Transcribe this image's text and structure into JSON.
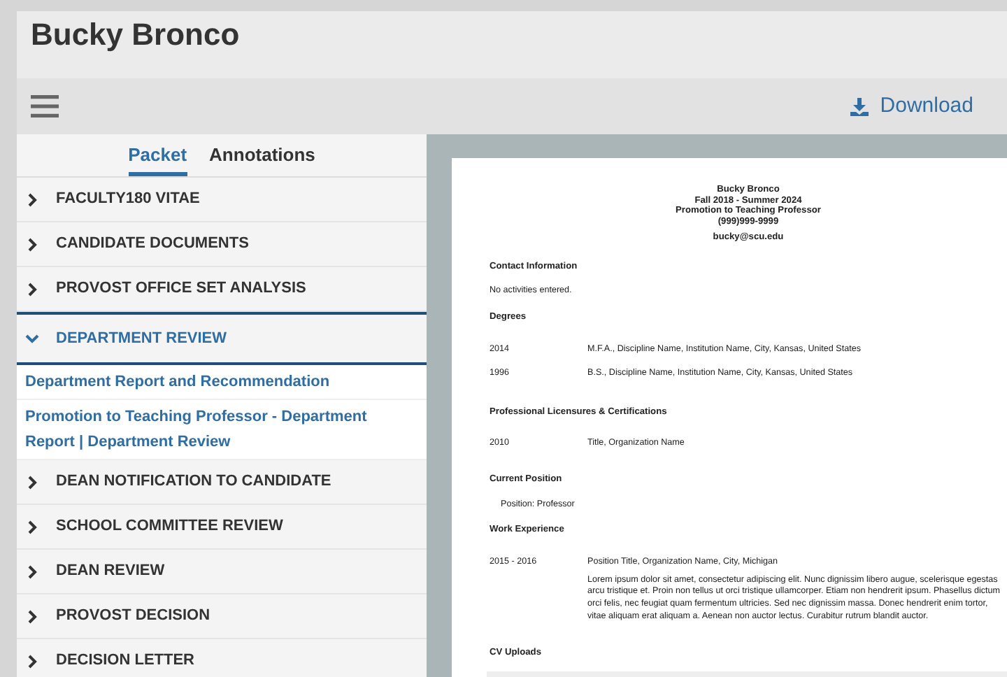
{
  "header": {
    "title": "Bucky Bronco"
  },
  "toolbar": {
    "download_label": "Download"
  },
  "tabs": [
    {
      "label": "Packet",
      "selected": true
    },
    {
      "label": "Annotations",
      "selected": false
    }
  ],
  "sections": [
    {
      "label": "FACULTY180 VITAE",
      "expanded": false
    },
    {
      "label": "CANDIDATE DOCUMENTS",
      "expanded": false
    },
    {
      "label": "PROVOST OFFICE SET ANALYSIS",
      "expanded": false
    },
    {
      "label": "DEPARTMENT REVIEW",
      "expanded": true,
      "children": [
        {
          "label": "Department Report and Recommendation"
        },
        {
          "label": "Promotion to Teaching Professor - Department Report | Department Review"
        }
      ]
    },
    {
      "label": "DEAN NOTIFICATION TO CANDIDATE",
      "expanded": false
    },
    {
      "label": "SCHOOL COMMITTEE REVIEW",
      "expanded": false
    },
    {
      "label": "DEAN REVIEW",
      "expanded": false
    },
    {
      "label": "PROVOST DECISION",
      "expanded": false
    },
    {
      "label": "DECISION LETTER",
      "expanded": false
    }
  ],
  "document": {
    "header_lines": [
      "Bucky Bronco",
      "Fall 2018 - Summer 2024",
      "Promotion to Teaching Professor",
      "(999)999-9999"
    ],
    "email": "bucky@scu.edu",
    "sections": [
      {
        "heading": "Contact Information",
        "note": "No activities entered."
      },
      {
        "heading": "Degrees",
        "rows": [
          {
            "date": "2014",
            "text": "M.F.A., Discipline Name, Institution Name, City, Kansas, United States"
          },
          {
            "date": "1996",
            "text": "B.S., Discipline Name, Institution Name, City, Kansas, United States"
          }
        ]
      },
      {
        "heading": "Professional Licensures & Certifications",
        "rows": [
          {
            "date": "2010",
            "text": "Title, Organization Name"
          }
        ]
      },
      {
        "heading": "Current Position",
        "indented_note": "Position: Professor"
      },
      {
        "heading": "Work Experience",
        "rows": [
          {
            "date": "2015 - 2016",
            "text": "Position Title, Organization Name, City, Michigan",
            "description": "Lorem ipsum dolor sit amet, consectetur adipiscing elit. Nunc dignissim libero augue, scelerisque egestas arcu tristique et. Proin non tellus ut orci tristique ullamcorper. Etiam non hendrerit ipsum. Phasellus dictum orci felis, nec feugiat quam fermentum ultricies. Sed nec dignissim massa. Donec hendrerit enim tortor, vitae aliquam erat aliquam a. Aenean non auctor lectus. Curabitur rutrum blandit auctor."
          }
        ]
      },
      {
        "heading": "CV Uploads",
        "table_stub": true
      }
    ]
  }
}
